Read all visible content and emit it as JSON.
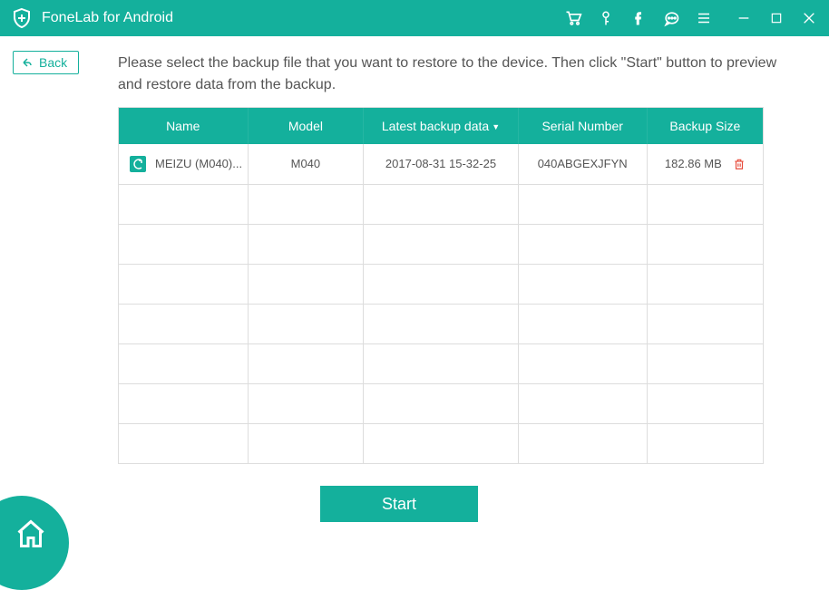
{
  "header": {
    "app_title": "FoneLab for Android"
  },
  "nav": {
    "back_label": "Back"
  },
  "main": {
    "instruction": "Please select the backup file that you want to restore to the device. Then click \"Start\" button to preview and restore data from the backup.",
    "columns": {
      "name": "Name",
      "model": "Model",
      "latest_backup": "Latest backup data",
      "serial": "Serial Number",
      "size": "Backup Size"
    },
    "rows": [
      {
        "name": "MEIZU (M040)...",
        "model": "M040",
        "latest_backup": "2017-08-31 15-32-25",
        "serial": "040ABGEXJFYN",
        "size": "182.86 MB"
      }
    ],
    "start_label": "Start"
  }
}
